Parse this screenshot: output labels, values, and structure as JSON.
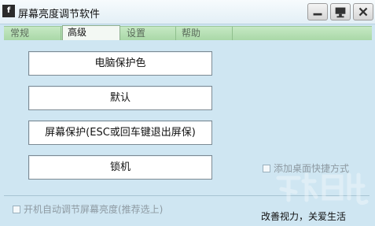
{
  "window": {
    "title": "屏幕亮度调节软件",
    "app_icon_glyph": "f",
    "controls": [
      "minimize-icon",
      "monitor-icon",
      "close-icon"
    ]
  },
  "tabs": [
    {
      "label": "常规",
      "active": false
    },
    {
      "label": "高级",
      "active": true
    },
    {
      "label": "设置",
      "active": false
    },
    {
      "label": "帮助",
      "active": false
    }
  ],
  "buttons": {
    "eye_care": "电脑保护色",
    "default": "默认",
    "screen_saver": "屏幕保护(ESC或回车键退出屏保)",
    "lock": "锁机"
  },
  "options": {
    "desktop_shortcut": "添加桌面快捷方式",
    "auto_adjust": "开机自动调节屏幕亮度(推荐选上)"
  },
  "footer": {
    "slogan": "改善视力，关爱生活"
  },
  "colors": {
    "window_bg": "#cfe6f2",
    "tab_bar": "#b6e0b4",
    "active_tab": "#f3f8f3"
  }
}
